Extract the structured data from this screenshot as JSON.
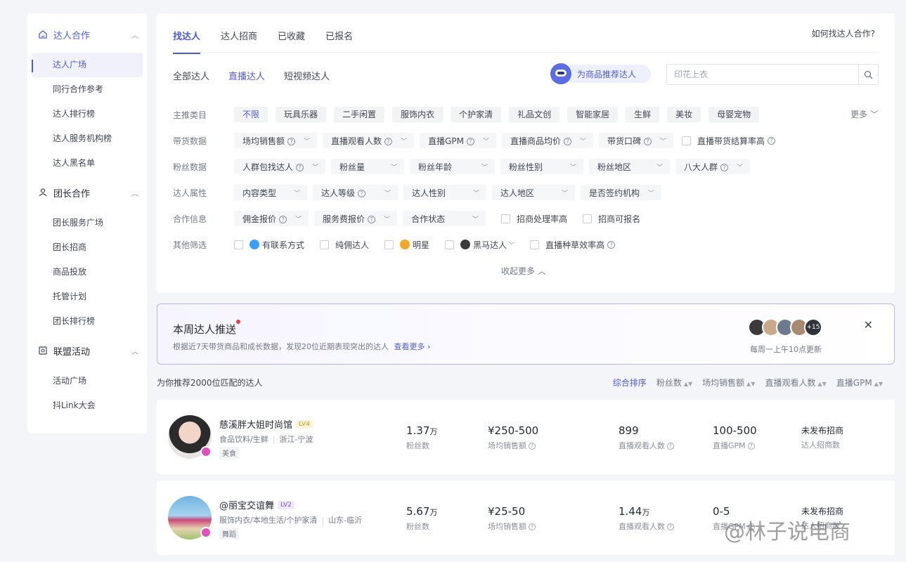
{
  "sidebar": {
    "groups": [
      {
        "label": "达人合作",
        "items": [
          "达人广场",
          "同行合作参考",
          "达人排行榜",
          "达人服务机构榜",
          "达人黑名单"
        ]
      },
      {
        "label": "团长合作",
        "items": [
          "团长服务广场",
          "团长招商",
          "商品投放",
          "托管计划",
          "团长排行榜"
        ]
      },
      {
        "label": "联盟活动",
        "items": [
          "活动广场",
          "抖Link大会"
        ]
      }
    ]
  },
  "tabs": [
    "找达人",
    "达人招商",
    "已收藏",
    "已报名"
  ],
  "help_link": "如何找达人合作?",
  "subtabs": [
    "全部达人",
    "直播达人",
    "短视频达人"
  ],
  "recommend_button": "为商品推荐达人",
  "search": {
    "placeholder": "印花上衣"
  },
  "filters": {
    "category": {
      "label": "主推类目",
      "chips": [
        "不限",
        "玩具乐器",
        "二手闲置",
        "服饰内衣",
        "个护家清",
        "礼品文创",
        "智能家居",
        "生鲜",
        "美妆",
        "母婴宠物"
      ],
      "more": "更多"
    },
    "sales": {
      "label": "带货数据",
      "dropdowns": [
        "场均销售额",
        "直播观看人数",
        "直播GPM",
        "直播商品均价",
        "带货口碑"
      ],
      "checkbox": "直播带货结算率高"
    },
    "fans": {
      "label": "粉丝数据",
      "dropdowns": [
        "人群包找达人",
        "粉丝量",
        "粉丝年龄",
        "粉丝性别",
        "粉丝地区",
        "八大人群"
      ]
    },
    "attrs": {
      "label": "达人属性",
      "dropdowns": [
        "内容类型",
        "达人等级",
        "达人性别",
        "达人地区",
        "是否签约机构"
      ]
    },
    "coop": {
      "label": "合作信息",
      "dropdowns": [
        "佣金报价",
        "服务费报价",
        "合作状态"
      ],
      "checkboxes": [
        "招商处理率高",
        "招商可报名"
      ]
    },
    "other": {
      "label": "其他筛选",
      "checkboxes": [
        "有联系方式",
        "纯佣达人",
        "明星",
        "黑马达人",
        "直播种草效率高"
      ]
    },
    "collapse": "收起更多"
  },
  "push": {
    "title": "本周达人推送",
    "desc": "根据近7天带货商品和成长数据，发现20位近期表现突出的达人",
    "link": "查看更多",
    "more_count": "+15",
    "schedule": "每周一上午10点更新"
  },
  "results": {
    "title": "为你推荐2000位匹配的达人",
    "sorts": [
      "综合排序",
      "粉丝数",
      "场均销售额",
      "直播观看人数",
      "直播GPM"
    ]
  },
  "creators": [
    {
      "name": "慈溪胖大姐时尚馆",
      "level": "LV4",
      "categories": "食品饮料/生鲜",
      "region": "浙江-宁波",
      "tag": "美食",
      "fans": "1.37",
      "fans_unit": "万",
      "fans_label": "粉丝数",
      "sales": "¥250-500",
      "sales_label": "场均销售额",
      "viewers": "899",
      "viewers_unit": "",
      "viewers_label": "直播观看人数",
      "gpm": "100-500",
      "gpm_label": "直播GPM",
      "status": "未发布招商",
      "status_label": "达人招商数"
    },
    {
      "name": "@丽宝交谊舞",
      "level": "LV2",
      "categories": "服饰内衣/本地生活/个护家清",
      "region": "山东-临沂",
      "tag": "舞蹈",
      "fans": "5.67",
      "fans_unit": "万",
      "fans_label": "粉丝数",
      "sales": "¥25-50",
      "sales_label": "场均销售额",
      "viewers": "1.44",
      "viewers_unit": "万",
      "viewers_label": "直播观看人数",
      "gpm": "0-5",
      "gpm_label": "直播GPM",
      "status": "未发布招商",
      "status_label": "达人招商数"
    }
  ],
  "watermark": "@林子说电商",
  "colors": {
    "accent": "#4e5bd6",
    "background": "#f4f5f9"
  }
}
